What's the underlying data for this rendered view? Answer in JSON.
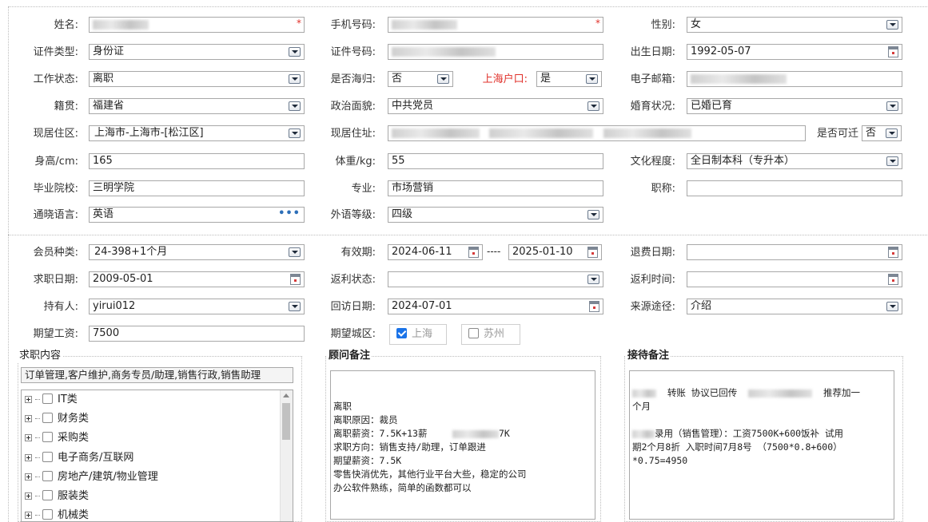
{
  "personal": {
    "name": {
      "label": "姓名:",
      "required": "*"
    },
    "phone": {
      "label": "手机号码:",
      "required": "*"
    },
    "gender": {
      "label": "性别:",
      "value": "女"
    },
    "id_type": {
      "label": "证件类型:",
      "value": "身份证"
    },
    "id_number": {
      "label": "证件号码:"
    },
    "birth_date": {
      "label": "出生日期:",
      "value": "1992-05-07"
    },
    "work_status": {
      "label": "工作状态:",
      "value": "离职"
    },
    "returnee": {
      "label": "是否海归:",
      "value": "否"
    },
    "shanghai_hukou": {
      "label": "上海户口:",
      "value": "是"
    },
    "email": {
      "label": "电子邮箱:"
    },
    "native_place": {
      "label": "籍贯:",
      "value": "福建省"
    },
    "political": {
      "label": "政治面貌:",
      "value": "中共党员"
    },
    "marital": {
      "label": "婚育状况:",
      "value": "已婚已育"
    },
    "residence_area": {
      "label": "现居住区:",
      "value": "上海市-上海市-[松江区]"
    },
    "residence_addr": {
      "label": "现居住址:"
    },
    "relocate": {
      "label": "是否可迁",
      "value": "否"
    },
    "height": {
      "label": "身高/cm:",
      "value": "165"
    },
    "weight": {
      "label": "体重/kg:",
      "value": "55"
    },
    "education": {
      "label": "文化程度:",
      "value": "全日制本科（专升本）"
    },
    "school": {
      "label": "毕业院校:",
      "value": "三明学院"
    },
    "major": {
      "label": "专业:",
      "value": "市场营销"
    },
    "title": {
      "label": "职称:",
      "value": ""
    },
    "language": {
      "label": "通晓语言:",
      "value": "英语",
      "more": "•••"
    },
    "foreign_level": {
      "label": "外语等级:",
      "value": "四级"
    }
  },
  "membership": {
    "member_type": {
      "label": "会员种类:",
      "value": "24-398+1个月"
    },
    "validity": {
      "label": "有效期:",
      "start": "2024-06-11",
      "sep": "----",
      "end": "2025-01-10"
    },
    "refund_date": {
      "label": "退费日期:",
      "value": ""
    },
    "job_date": {
      "label": "求职日期:",
      "value": "2009-05-01"
    },
    "rebate_status": {
      "label": "返利状态:",
      "value": ""
    },
    "rebate_time": {
      "label": "返利时间:",
      "value": ""
    },
    "holder": {
      "label": "持有人:",
      "value": "yirui012"
    },
    "visit_date": {
      "label": "回访日期:",
      "value": "2024-07-01"
    },
    "source": {
      "label": "来源途径:",
      "value": "介绍"
    },
    "salary": {
      "label": "期望工资:",
      "value": "7500"
    },
    "city": {
      "label": "期望城区:",
      "options": [
        {
          "label": "上海",
          "checked": true
        },
        {
          "label": "苏州",
          "checked": false
        }
      ]
    }
  },
  "job_content": {
    "legend": "求职内容",
    "summary": "订单管理,客户维护,商务专员/助理,销售行政,销售助理",
    "tree": [
      "IT类",
      "财务类",
      "采购类",
      "电子商务/互联网",
      "房地产/建筑/物业管理",
      "服装类",
      "机械类"
    ]
  },
  "advisor_notes": {
    "legend": "顾问备注",
    "lines": [
      "",
      "",
      "离职",
      "离职原因：裁员",
      "离职薪资：7.5K+13薪",
      "求职方向：销售支持/助理，订单跟进",
      "期望薪资：7.5K",
      "零售快消优先，其他行业平台大些，稳定的公司",
      "办公软件熟练，简单的函数都可以"
    ],
    "tail_7k": "7K"
  },
  "reception_notes": {
    "legend": "接待备注",
    "line1a": "转账  协议已回传",
    "line1b": "推荐加一",
    "line2": "个月",
    "line4": "录用（销售管理）：工资7500K+600饭补  试用",
    "line5": "期2个月8折  入职时间7月8号   （7500*0.8+600）",
    "line6": "*0.75=4950"
  }
}
